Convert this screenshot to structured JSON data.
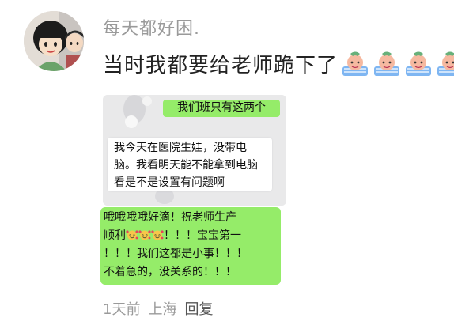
{
  "post": {
    "username": "每天都好困.",
    "comment_text": "当时我都要给老师跪下了",
    "reaction_icon": "pray-emoji",
    "reaction_count": 4
  },
  "screenshot1": {
    "sent_message": "我们班只有这两个",
    "received_message": "我今天在医院生娃，没带电脑。我看明天能不能拿到电脑看是不是设置有问题啊"
  },
  "screenshot2": {
    "line1": "哦哦哦哦好滴！祝老师生产",
    "line2_start": "顺利",
    "line2_end": "！！！宝宝第一",
    "line3": "！！！我们这都是小事！！！",
    "line4": "不着急的，没关系的！！！",
    "emoji_icon": "smiling-face-with-hearts",
    "emoji_count": 3
  },
  "meta": {
    "time": "1天前",
    "location": "上海",
    "reply": "回复"
  },
  "colors": {
    "bubble_green": "#95ec69",
    "meta_gray": "#9a9a9a"
  }
}
